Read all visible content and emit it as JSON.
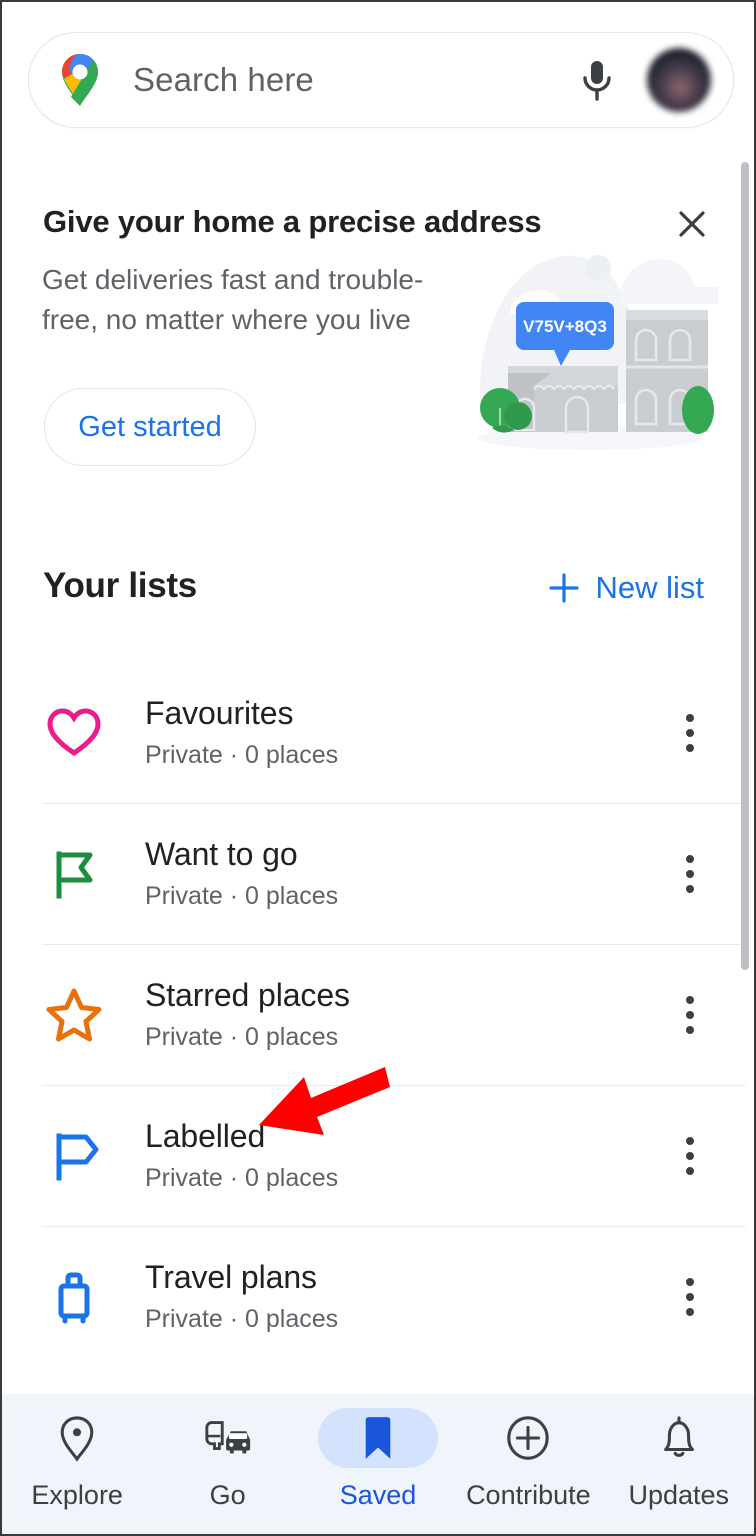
{
  "search": {
    "placeholder": "Search here",
    "logo_icon": "google-maps-pin-icon",
    "mic_icon": "microphone-icon",
    "avatar_icon": "account-avatar"
  },
  "promo": {
    "title": "Give your home a precise address",
    "body": "Get deliveries fast and trouble-free, no matter where you live",
    "cta_label": "Get started",
    "close_icon": "close-icon",
    "pluscode_badge": "V75V+8Q3",
    "illustration_icon": "house-address-illustration",
    "badge_color": "#4285F4"
  },
  "lists_section": {
    "title": "Your lists",
    "new_list_label": "New list",
    "new_list_icon": "plus-icon",
    "accent_color": "#1A73E8"
  },
  "lists": [
    {
      "name": "Favourites",
      "meta": "Private · 0 places",
      "icon": "heart-icon",
      "icon_color": "#E91E8C"
    },
    {
      "name": "Want to go",
      "meta": "Private · 0 places",
      "icon": "flag-icon",
      "icon_color": "#1E8E3E"
    },
    {
      "name": "Starred places",
      "meta": "Private · 0 places",
      "icon": "star-icon",
      "icon_color": "#E8710A"
    },
    {
      "name": "Labelled",
      "meta": "Private · 0 places",
      "icon": "label-flag-icon",
      "icon_color": "#1A73E8"
    },
    {
      "name": "Travel plans",
      "meta": "Private · 0 places",
      "icon": "suitcase-icon",
      "icon_color": "#1A73E8"
    }
  ],
  "row_menu_icon": "more-vertical-icon",
  "annotation": {
    "type": "arrow",
    "color": "#FF0000",
    "points_at": "Labelled"
  },
  "bottom_nav": {
    "active": "Saved",
    "active_pill_color": "#D3E3FD",
    "items": [
      {
        "label": "Explore",
        "icon": "location-pin-icon"
      },
      {
        "label": "Go",
        "icon": "commute-icon"
      },
      {
        "label": "Saved",
        "icon": "bookmark-icon"
      },
      {
        "label": "Contribute",
        "icon": "plus-circle-icon"
      },
      {
        "label": "Updates",
        "icon": "bell-icon"
      }
    ]
  }
}
